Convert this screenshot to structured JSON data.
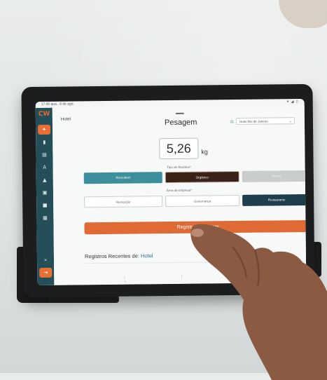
{
  "status_bar": {
    "time_date": "17:00 qua., 6 de ago.",
    "indicators": "▾ ◢ ▯"
  },
  "sidebar": {
    "logo": "CW",
    "items": [
      {
        "icon": "scale-icon",
        "glyph": "✦",
        "active": true
      },
      {
        "icon": "chart-icon",
        "glyph": "▮",
        "active": false
      },
      {
        "icon": "document-icon",
        "glyph": "▤",
        "active": false
      },
      {
        "icon": "text-icon",
        "glyph": "A",
        "active": false
      },
      {
        "icon": "flask-icon",
        "glyph": "▲",
        "active": false
      },
      {
        "icon": "bag-icon",
        "glyph": "▣",
        "active": false
      },
      {
        "icon": "truck-icon",
        "glyph": "■",
        "active": false
      },
      {
        "icon": "building-icon",
        "glyph": "▦",
        "active": false
      }
    ],
    "expand_glyph": "»",
    "logout_glyph": "⇥"
  },
  "header": {
    "breadcrumb": "Hotel",
    "title": "Pesagem",
    "hotel_select": "Hotel Rio de Janeiro"
  },
  "weight": {
    "value": "5,26",
    "unit": "kg"
  },
  "waste_type": {
    "label": "Tipo de Resíduo*",
    "options": [
      {
        "label": "Reciclável",
        "state": "teal"
      },
      {
        "label": "Orgânico",
        "state": "selected"
      },
      {
        "label": "Rejeito",
        "state": "disabled"
      }
    ]
  },
  "company_area": {
    "label": "Área da empresa*",
    "options": [
      {
        "label": "Recepção",
        "state": "outline"
      },
      {
        "label": "Governança",
        "state": "outline"
      },
      {
        "label": "Restaurante",
        "state": "selected"
      }
    ]
  },
  "register_button": "Registrar Pesagem",
  "recent": {
    "prefix": "Registros Recentes de:",
    "place": "Hotel",
    "chevron": "▾"
  },
  "colors": {
    "sidebar": "#244e58",
    "accent_orange": "#e06a36",
    "teal": "#3e8f9d",
    "brown": "#3a2217",
    "navy": "#1f3e4c"
  }
}
